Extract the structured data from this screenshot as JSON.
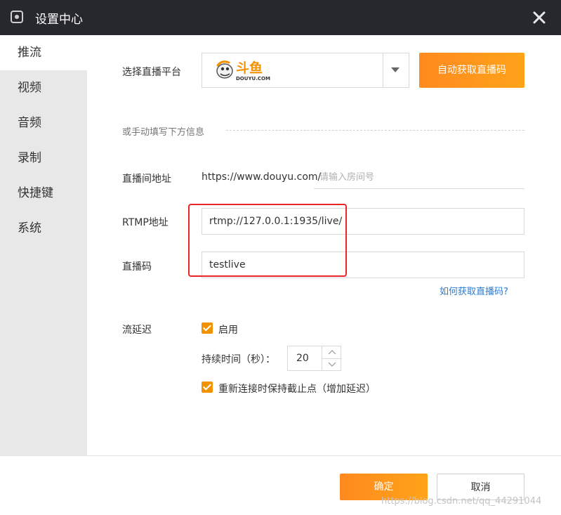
{
  "window": {
    "title": "设置中心"
  },
  "sidebar": {
    "items": [
      {
        "label": "推流",
        "active": true
      },
      {
        "label": "视频",
        "active": false
      },
      {
        "label": "音频",
        "active": false
      },
      {
        "label": "录制",
        "active": false
      },
      {
        "label": "快捷键",
        "active": false
      },
      {
        "label": "系统",
        "active": false
      }
    ]
  },
  "platform": {
    "label": "选择直播平台",
    "selected": "斗鱼",
    "selected_sub": "DOUYU.COM",
    "auto_button": "自动获取直播码"
  },
  "manual": {
    "divider_text": "或手动填写下方信息"
  },
  "room": {
    "label": "直播间地址",
    "prefix": "https://www.douyu.com/",
    "placeholder": "请输入房间号",
    "value": ""
  },
  "rtmp": {
    "label": "RTMP地址",
    "value": "rtmp://127.0.0.1:1935/live/"
  },
  "stream_key": {
    "label": "直播码",
    "value": "testlive",
    "help_link": "如何获取直播码?"
  },
  "delay": {
    "label": "流延迟",
    "enable_label": "启用",
    "enabled": true,
    "duration_label": "持续时间（秒）：",
    "duration_value": "20",
    "reconnect_label": "重新连接时保持截止点（增加延迟）",
    "reconnect_checked": true
  },
  "footer": {
    "ok": "确定",
    "cancel": "取消"
  },
  "watermark": "https://blog.csdn.net/qq_44291044",
  "colors": {
    "accent": "#f39200",
    "highlight_box": "#e8262a",
    "link": "#2b7cd3"
  }
}
